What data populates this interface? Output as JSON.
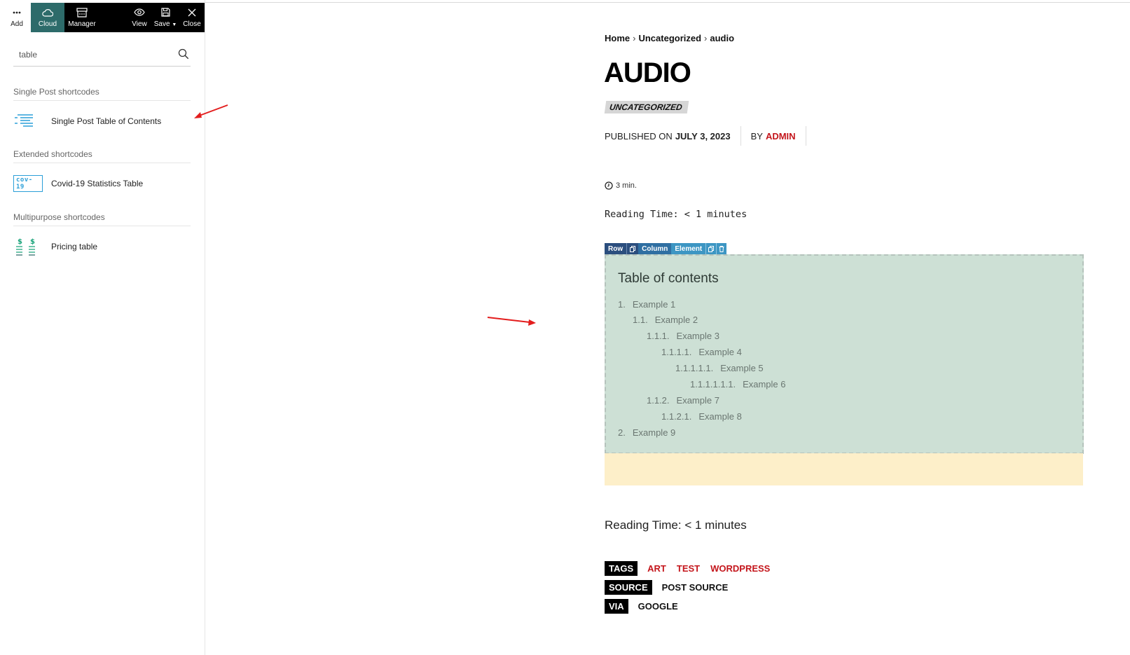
{
  "toolbar": {
    "add_label": "Add",
    "cloud_label": "Cloud",
    "manager_label": "Manager",
    "view_label": "View",
    "save_label": "Save",
    "close_label": "Close"
  },
  "search": {
    "value": "table"
  },
  "sections": [
    {
      "title": "Single Post shortcodes",
      "item": "Single Post Table of Contents",
      "icon": "toc-list-icon"
    },
    {
      "title": "Extended shortcodes",
      "item": "Covid-19 Statistics Table",
      "icon": "covid-badge-icon",
      "badge_text": "cov-19"
    },
    {
      "title": "Multipurpose shortcodes",
      "item": "Pricing table",
      "icon": "pricing-icon"
    }
  ],
  "article": {
    "breadcrumb": [
      "Home",
      "Uncategorized",
      "audio"
    ],
    "title": "AUDIO",
    "category": "UNCATEGORIZED",
    "published_prefix": "PUBLISHED ON",
    "date": "JULY 3, 2023",
    "by_prefix": "BY",
    "author": "ADMIN",
    "read_min": "3 min.",
    "reading_time_1": "Reading Time: < 1 minutes",
    "reading_time_2": "Reading Time: < 1 minutes"
  },
  "builder": {
    "row": "Row",
    "column": "Column",
    "element": "Element"
  },
  "toc": {
    "title": "Table of contents",
    "items": [
      {
        "num": "1.",
        "label": "Example 1"
      },
      {
        "num": "1.1.",
        "label": "Example 2"
      },
      {
        "num": "1.1.1.",
        "label": "Example 3"
      },
      {
        "num": "1.1.1.1.",
        "label": "Example 4"
      },
      {
        "num": "1.1.1.1.1.",
        "label": "Example 5"
      },
      {
        "num": "1.1.1.1.1.1.",
        "label": "Example 6"
      },
      {
        "num": "1.1.2.",
        "label": "Example 7"
      },
      {
        "num": "1.1.2.1.",
        "label": "Example 8"
      },
      {
        "num": "2.",
        "label": "Example 9"
      }
    ]
  },
  "footer": {
    "tags_label": "TAGS",
    "tags": [
      "ART",
      "TEST",
      "WORDPRESS"
    ],
    "source_label": "SOURCE",
    "source_value": "POST SOURCE",
    "via_label": "VIA",
    "via_value": "GOOGLE"
  },
  "colors": {
    "accent_red": "#c4161c",
    "cloud_teal": "#2d6b6a",
    "toc_bg": "#cde0d5",
    "band_yellow": "#fdefc9"
  }
}
